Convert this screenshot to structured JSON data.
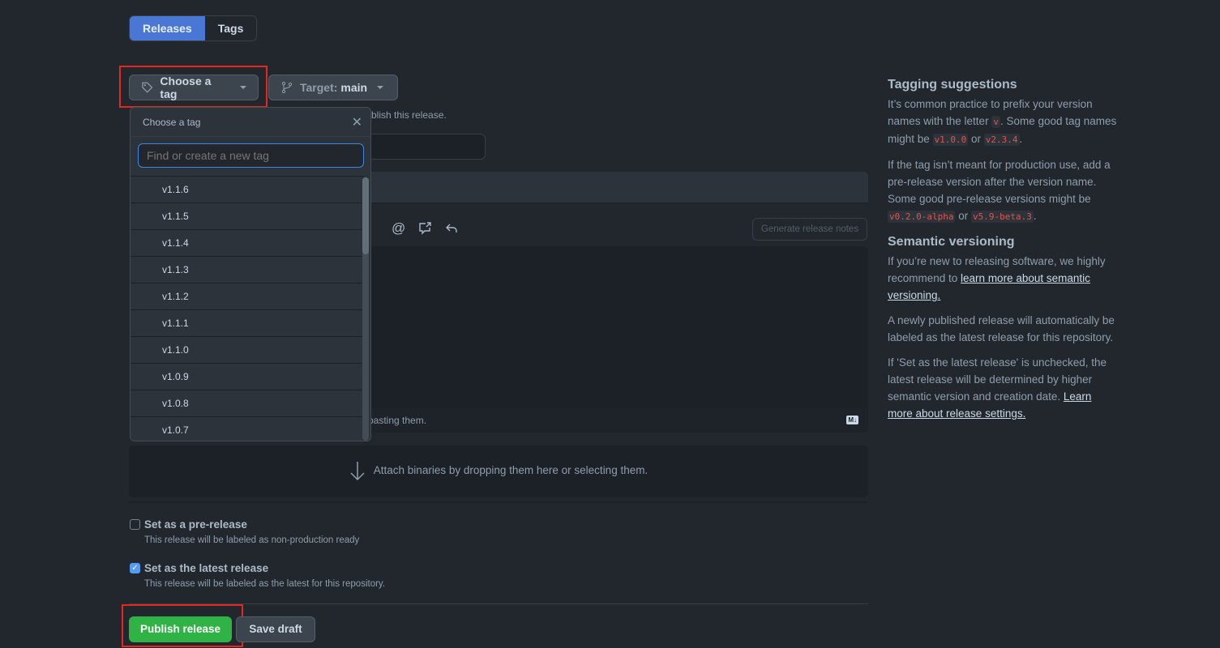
{
  "tabs": [
    {
      "label": "Releases",
      "active": true
    },
    {
      "label": "Tags",
      "active": false
    }
  ],
  "tag_button": {
    "label": "Choose a tag",
    "icon": "tag-icon"
  },
  "target_button": {
    "prefix": "Target:",
    "branch": "main",
    "icon": "git-branch-icon"
  },
  "partial_hint": "blish this release.",
  "dropdown": {
    "title": "Choose a tag",
    "search_placeholder": "Find or create a new tag",
    "tags": [
      "v1.1.6",
      "v1.1.5",
      "v1.1.4",
      "v1.1.3",
      "v1.1.2",
      "v1.1.1",
      "v1.1.0",
      "v1.0.9",
      "v1.0.8",
      "v1.0.7"
    ]
  },
  "editor": {
    "generate_notes": "Generate release notes",
    "footer_partial": "pasting them.",
    "markdown_badge": "M↓"
  },
  "attach": {
    "text": "Attach binaries by dropping them here or selecting them."
  },
  "options": [
    {
      "label": "Set as a pre-release",
      "desc": "This release will be labeled as non-production ready",
      "checked": false
    },
    {
      "label": "Set as the latest release",
      "desc": "This release will be labeled as the latest for this repository.",
      "checked": true
    }
  ],
  "actions": {
    "publish": "Publish release",
    "draft": "Save draft"
  },
  "sidebar": {
    "tagging_title": "Tagging suggestions",
    "p1a": "It’s common practice to prefix your version names with the letter ",
    "p1v": "v",
    "p1b": ". Some good tag names might be ",
    "p1c1": "v1.0.0",
    "p1or": " or ",
    "p1c2": "v2.3.4",
    "p1end": ".",
    "p2a": "If the tag isn’t meant for production use, add a pre-release version after the version name. Some good pre-release versions might be ",
    "p2c1": "v0.2.0-alpha",
    "p2or": " or ",
    "p2c2": "v5.9-beta.3",
    "p2end": ".",
    "semver_title": "Semantic versioning",
    "p3a": "If you’re new to releasing software, we highly recommend to ",
    "p3link": "learn more about semantic versioning.",
    "p4": "A newly published release will automatically be labeled as the latest release for this repository.",
    "p5a": "If 'Set as the latest release' is unchecked, the latest release will be determined by higher semantic version and creation date. ",
    "p5link": "Learn more about release settings."
  },
  "colors": {
    "background": "#22272e",
    "accent": "#4a77d4",
    "publish": "#2fb344",
    "highlight": "#e5281f"
  }
}
